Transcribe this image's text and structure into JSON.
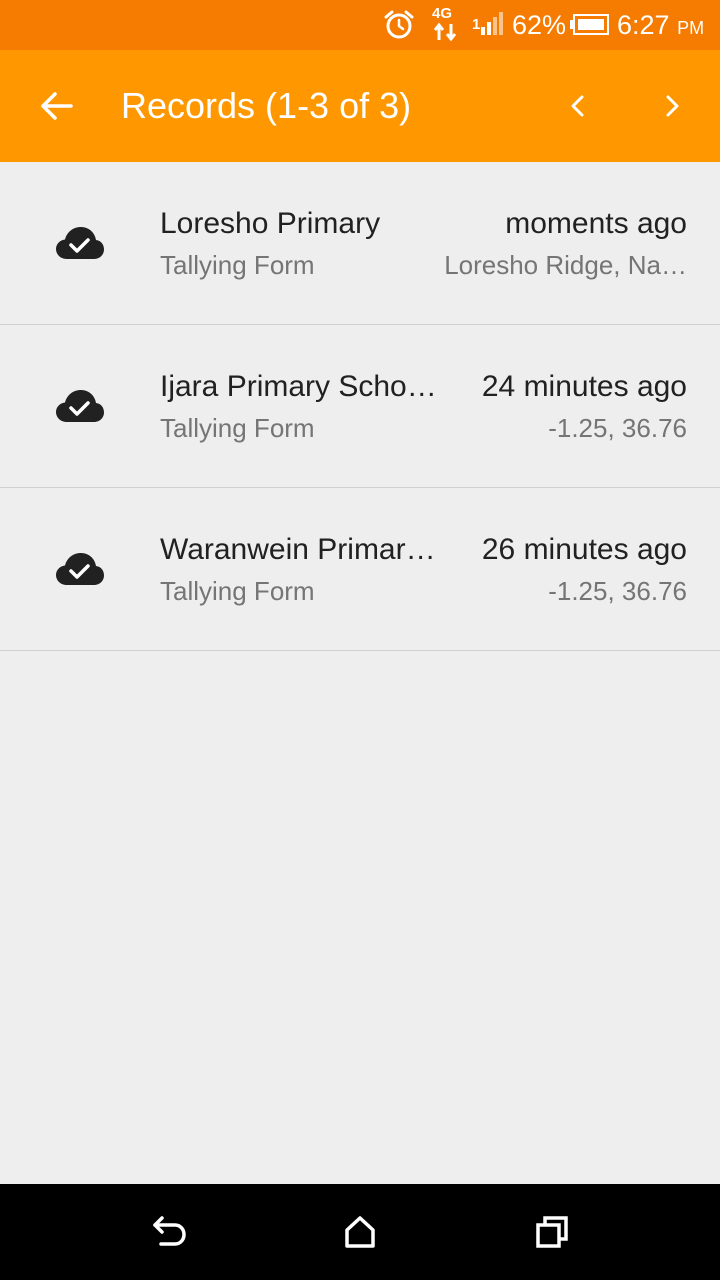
{
  "status_bar": {
    "network": "4G",
    "signal_label": "1",
    "battery": "62%",
    "time": "6:27",
    "ampm": "PM",
    "icons": [
      "alarm-icon",
      "network-4g-icon",
      "signal-icon",
      "battery-icon"
    ]
  },
  "app_bar": {
    "title": "Records (1-3 of 3)",
    "icons": [
      "back-arrow-icon",
      "chevron-left-icon",
      "chevron-right-icon"
    ]
  },
  "records": [
    {
      "name": "Loresho Primary",
      "form": "Tallying Form",
      "time": "moments ago",
      "location": "Loresho Ridge, Na…",
      "icon": "cloud-check-icon"
    },
    {
      "name": "Ijara Primary Scho…",
      "form": "Tallying Form",
      "time": "24 minutes ago",
      "location": "-1.25, 36.76",
      "icon": "cloud-check-icon"
    },
    {
      "name": "Waranwein Primar…",
      "form": "Tallying Form",
      "time": "26 minutes ago",
      "location": "-1.25, 36.76",
      "icon": "cloud-check-icon"
    }
  ],
  "nav_bar": {
    "icons": [
      "nav-back-icon",
      "nav-home-icon",
      "nav-recents-icon"
    ]
  },
  "colors": {
    "status_bar": "#f57c00",
    "app_bar": "#ff9800",
    "background": "#eeeeee",
    "primary_text": "#212121",
    "secondary_text": "#757575",
    "nav_bar": "#000000"
  }
}
